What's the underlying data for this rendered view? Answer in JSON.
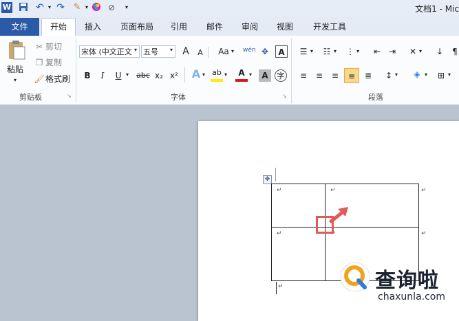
{
  "titlebar": {
    "doc_title": "文档1 - Mic"
  },
  "tabs": {
    "file": "文件",
    "home": "开始",
    "insert": "插入",
    "page_layout": "页面布局",
    "references": "引用",
    "mailings": "邮件",
    "review": "审阅",
    "view": "视图",
    "developer": "开发工具"
  },
  "clipboard": {
    "paste": "粘贴",
    "cut": "剪切",
    "copy": "复制",
    "format_painter": "格式刷",
    "group_label": "剪贴板"
  },
  "font": {
    "font_name": "宋体 (中文正文",
    "font_size": "五号",
    "grow": "A",
    "shrink": "A",
    "change_case": "Aa",
    "bold": "B",
    "italic": "I",
    "underline": "U",
    "strike": "abc",
    "subscript": "x₂",
    "superscript": "x²",
    "text_effect": "A",
    "highlight": "ab",
    "font_color": "A",
    "char_shading": "A",
    "enclose": "字",
    "group_label": "字体"
  },
  "paragraph": {
    "group_label": "段落"
  },
  "watermark": {
    "main": "查询啦",
    "sub": "chaxunla.com"
  },
  "colors": {
    "file_tab": "#2a5aa8",
    "arrow": "#e05a57",
    "logo_orange": "#f5a21b",
    "logo_blue": "#2c7be5"
  }
}
